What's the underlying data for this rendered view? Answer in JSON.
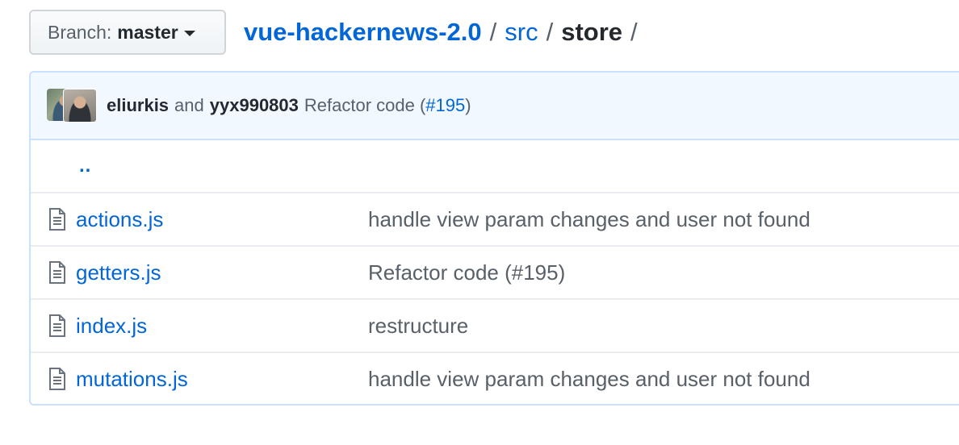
{
  "branch": {
    "prefix": "Branch:",
    "name": "master"
  },
  "breadcrumb": {
    "repo": "vue-hackernews-2.0",
    "folder": "src",
    "current": "store",
    "separator": "/"
  },
  "commit": {
    "author1": "eliurkis",
    "conjunction": "and",
    "author2": "yyx990803",
    "message_prefix": "Refactor code (",
    "pr": "#195",
    "message_suffix": ")"
  },
  "updir": "..",
  "files": [
    {
      "name": "actions.js",
      "message": "handle view param changes and user not found",
      "icon": "file-icon"
    },
    {
      "name": "getters.js",
      "message": "Refactor code (#195)",
      "icon": "file-icon"
    },
    {
      "name": "index.js",
      "message": "restructure",
      "icon": "file-icon"
    },
    {
      "name": "mutations.js",
      "message": "handle view param changes and user not found",
      "icon": "file-icon"
    }
  ],
  "colors": {
    "link": "#0366d6",
    "muted": "#586069",
    "commit_bg": "#f1f8ff",
    "commit_border": "#c8e1ff"
  }
}
